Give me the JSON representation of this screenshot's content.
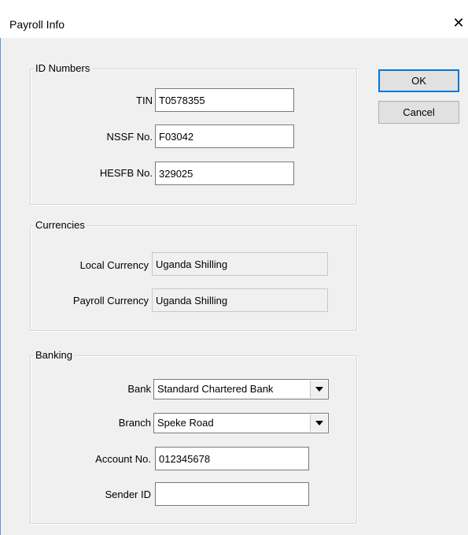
{
  "window": {
    "title": "Payroll Info",
    "close_glyph": "✕"
  },
  "buttons": {
    "ok": "OK",
    "cancel": "Cancel"
  },
  "id_numbers": {
    "legend": "ID Numbers",
    "tin_label": "TIN",
    "tin_value": "T0578355",
    "nssf_label": "NSSF No.",
    "nssf_value": "F03042",
    "hesfb_label": "HESFB No.",
    "hesfb_value": "329025"
  },
  "currencies": {
    "legend": "Currencies",
    "local_label": "Local Currency",
    "local_value": "Uganda Shilling",
    "payroll_label": "Payroll Currency",
    "payroll_value": "Uganda Shilling"
  },
  "banking": {
    "legend": "Banking",
    "bank_label": "Bank",
    "bank_value": "Standard Chartered Bank",
    "branch_label": "Branch",
    "branch_value": "Speke Road",
    "account_label": "Account No.",
    "account_value": "012345678",
    "sender_label": "Sender ID",
    "sender_value": ""
  }
}
